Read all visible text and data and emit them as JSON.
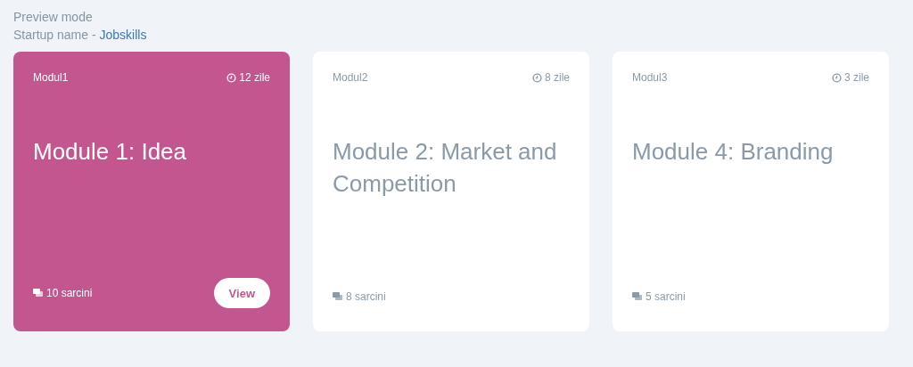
{
  "header": {
    "mode": "Preview mode",
    "startup_label": "Startup name - ",
    "startup_name": "Jobskills"
  },
  "modules": [
    {
      "code": "Modul1",
      "duration": "12 zile",
      "title": "Module 1: Idea",
      "tasks": "10 sarcini",
      "selected": true,
      "button": "View"
    },
    {
      "code": "Modul2",
      "duration": "8 zile",
      "title": "Module 2: Market and Competition",
      "tasks": "8 sarcini",
      "selected": false
    },
    {
      "code": "Modul3",
      "duration": "3 zile",
      "title": "Module 4: Branding",
      "tasks": "5 sarcini",
      "selected": false
    }
  ]
}
